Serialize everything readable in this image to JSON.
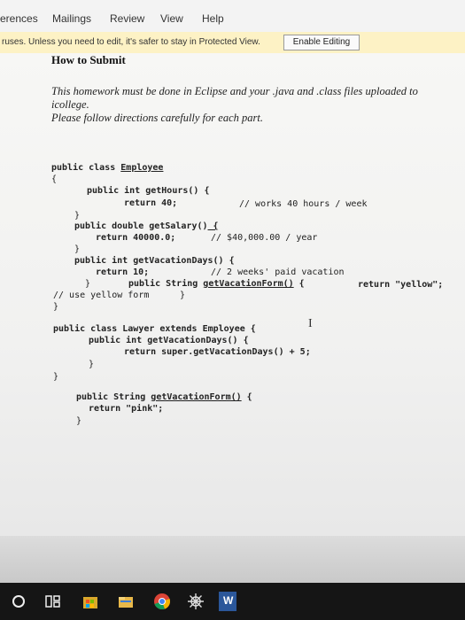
{
  "menu": {
    "items": [
      "erences",
      "Mailings",
      "Review",
      "View",
      "Help"
    ]
  },
  "protected_view": {
    "message": "ruses. Unless you need to edit, it's safer to stay in Protected View.",
    "button": "Enable Editing",
    "color": "#fdf2c5"
  },
  "document": {
    "heading": "How to Submit",
    "intro": [
      "This homework must be done in Eclipse and your .java and .class files uploaded to",
      "icollege.",
      "Please follow directions carefully for each part."
    ],
    "code": {
      "l1_kw": "public class ",
      "l1_name": "Employee",
      "l2": "{",
      "l3": "public int getHours() {",
      "l4": "return 40;",
      "l4c": "// works 40 hours / week",
      "l5": "}",
      "l6a": "public double getSalary()",
      "l6b": " {",
      "l7": "return 40000.0;",
      "l7c": "// $40,000.00 / year",
      "l8": "}",
      "l9": "public int getVacationDays() {",
      "l10": "return 10;",
      "l10c": "// 2 weeks' paid vacation",
      "l11a": "}",
      "l11b": "public String ",
      "l11c": "getVacationForm()",
      "l11d": " {",
      "l11r": "return \"yellow\";",
      "l12": "// use yellow form",
      "l12b": "}",
      "l13": "}",
      "l14": "public class Lawyer extends Employee {",
      "l15": "public int getVacationDays() {",
      "l16": "return super.getVacationDays() + 5;",
      "l17": "}",
      "l18": "}",
      "l19a": "public String ",
      "l19b": "getVacationForm()",
      "l19c": " {",
      "l20": "return \"pink\";",
      "l21": "}"
    }
  },
  "taskbar": {
    "icons": [
      "cortana-circle-icon",
      "task-view-icon",
      "store-icon",
      "file-explorer-icon",
      "chrome-icon",
      "network-gear-icon",
      "word-icon"
    ],
    "word_letter": "W"
  }
}
